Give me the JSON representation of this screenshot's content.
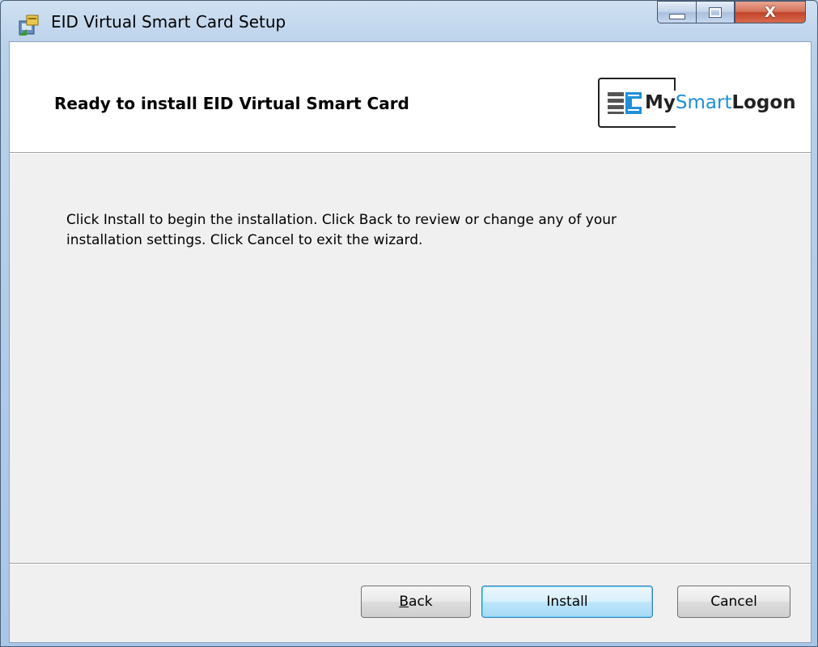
{
  "window": {
    "title": "EID Virtual Smart Card Setup"
  },
  "caption_buttons": {
    "close_glyph": "X"
  },
  "banner": {
    "title": "Ready to install EID Virtual Smart Card",
    "logo": {
      "prefix": "My",
      "middle": "Smart",
      "suffix": "Logon",
      "accent_color": "#1f8fd8"
    }
  },
  "body": {
    "line1": "Click Install to begin the installation. Click Back to review or change any of your",
    "line2": "installation settings. Click Cancel to exit the wizard."
  },
  "buttons": {
    "back_mnemonic": "B",
    "back_rest": "ack",
    "install": "Install",
    "cancel": "Cancel"
  },
  "icons": [
    "setup-installer-icon",
    "minimize-icon",
    "maximize-icon",
    "close-icon",
    "smart-card-chip-icon"
  ]
}
